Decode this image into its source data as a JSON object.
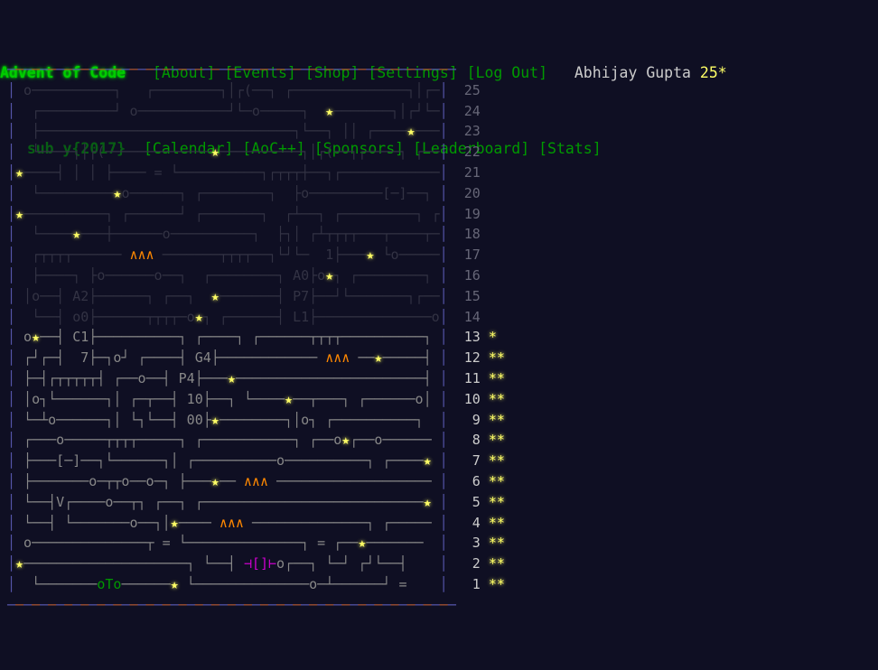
{
  "site": {
    "title": "Advent of Code",
    "year_sub_prefix": "sub y{",
    "year": "2017",
    "year_sub_suffix": "}",
    "background": "#0f0f23",
    "accent_green": "#00cc00",
    "star_yellow": "#ffff66",
    "resistor_orange": "#ff8800"
  },
  "nav": {
    "row1": [
      {
        "label": "[About]"
      },
      {
        "label": "[Events]"
      },
      {
        "label": "[Shop]"
      },
      {
        "label": "[Settings]"
      },
      {
        "label": "[Log Out]"
      }
    ],
    "row2": [
      {
        "label": "[Calendar]"
      },
      {
        "label": "[AoC++]"
      },
      {
        "label": "[Sponsors]"
      },
      {
        "label": "[Leaderboard]"
      },
      {
        "label": "[Stats]"
      }
    ]
  },
  "user": {
    "name": "Abhijay Gupta",
    "stars": "25",
    "star_glyph": "*"
  },
  "calendar": {
    "border_top": "- - - - - - - - - - - - - - - - - - - - - - - - - - - -",
    "days": [
      {
        "day": "25",
        "stars": "",
        "complete": false
      },
      {
        "day": "24",
        "stars": "",
        "complete": false
      },
      {
        "day": "23",
        "stars": "",
        "complete": false
      },
      {
        "day": "22",
        "stars": "",
        "complete": false
      },
      {
        "day": "21",
        "stars": "",
        "complete": false
      },
      {
        "day": "20",
        "stars": "",
        "complete": false
      },
      {
        "day": "19",
        "stars": "",
        "complete": false
      },
      {
        "day": "18",
        "stars": "",
        "complete": false
      },
      {
        "day": "17",
        "stars": "",
        "complete": false
      },
      {
        "day": "16",
        "stars": "",
        "complete": false
      },
      {
        "day": "15",
        "stars": "",
        "complete": false
      },
      {
        "day": "14",
        "stars": "",
        "complete": false
      },
      {
        "day": "13",
        "stars": "*",
        "complete": true
      },
      {
        "day": "12",
        "stars": "**",
        "complete": true
      },
      {
        "day": "11",
        "stars": "**",
        "complete": true
      },
      {
        "day": "10",
        "stars": "**",
        "complete": true
      },
      {
        "day": " 9",
        "stars": "**",
        "complete": true
      },
      {
        "day": " 8",
        "stars": "**",
        "complete": true
      },
      {
        "day": " 7",
        "stars": "**",
        "complete": true
      },
      {
        "day": " 6",
        "stars": "**",
        "complete": true
      },
      {
        "day": " 5",
        "stars": "**",
        "complete": true
      },
      {
        "day": " 4",
        "stars": "**",
        "complete": true
      },
      {
        "day": " 3",
        "stars": "**",
        "complete": true
      },
      {
        "day": " 2",
        "stars": "**",
        "complete": true
      },
      {
        "day": " 1",
        "stars": "**",
        "complete": true
      }
    ],
    "art_rows": [
      " o──────────┐   ┌────────┐│┌(──┐ ┌──────────────┐│┌──",
      "  ┌─────────┘ o───────────┘└─o─────┐  ★───────┐│┌┘└──",
      "  ├───────────────────────────────┐└──┐ ││ ┌────★────",
      "  └────┐│┌(─────────────★──────────┐│┌(──┐┌────┐ ┌──o",
      "★────┤ │ │ ├──── = └──────────┐┌┬┬┬┼──┐┌────────────┐",
      "  └─────────★o──────┐ ┌────────┐  ├o─────────[─]──┐ ",
      "★──────────┐ ┌──────┘ ┌───────┐  ┌┴──┐ ┌─────────┐ ┌",
      "  └────★───┼──────o──────────┐  ├┐│ ┌┴┬┬┬┬───┬────┬─",
      "  ┌┬┬┬┬────── ∧∧∧ ───────┬┬┬┬──┐└┘└─  1├───★ └o─────",
      "  ├────┐ ├o──────o──┐  ┌────────┐ A0├o★┐ ┌────────┐ ",
      " │o──┤ A2├──────┐ ┌──┐  ★───────┤ P7├──┘└───────┐┌──",
      "  └──┤ o0├──────┬┬┬┬─o★┐ ┌──────┤ L1├──────────────o",
      " o★──┤ C1├──────────┐ ┌────┐ ┌──────┬┬┬┬──────────┐ ",
      " ┌┘┌─┤  7├─┐o┘ ┌────┤ G4├──────────── ∧∧∧ ──★─────┤ ",
      " ├─┤┌┬┬┬┬┬┤ ┌──o──┤ P4├───★───────────────────────┤ ",
      " │o┐└──────┐│ ┌─┬──┤ 10├──┐ └────★──┬───┐ ┌──────o│ ",
      " └─┴o──────┐│ └┐└──┤ 00├★────────┐│o┐ ┌──────────┐ ",
      " ┌───o─────┬┬┬┬─────┐ ┌───────────┐ ┌──o★┌──o──────",
      " ├───[─]──┐└──────┐│ ┌──────────o──────────┐ ┌────★",
      " ├───────o─┬┬o──o─┐ ├───★── ∧∧∧ ───────────────────",
      " └──┤V┌────o──┬┐ ┌──┐ ┌───────────────────────────★",
      " └──┤ └───────o──┐│★──── ∧∧∧ ──────────────┐ ┌─────",
      " o──────────────┬ = └──────────────┐ = ┌──★───────",
      "★────────────────────┐ └──┤ ⊣[]⊢o┌──┐ └─┘ ┌┘└──┤  ",
      "  └───────oTo──────★ └──────────────o─┴──────┘ =  "
    ]
  }
}
